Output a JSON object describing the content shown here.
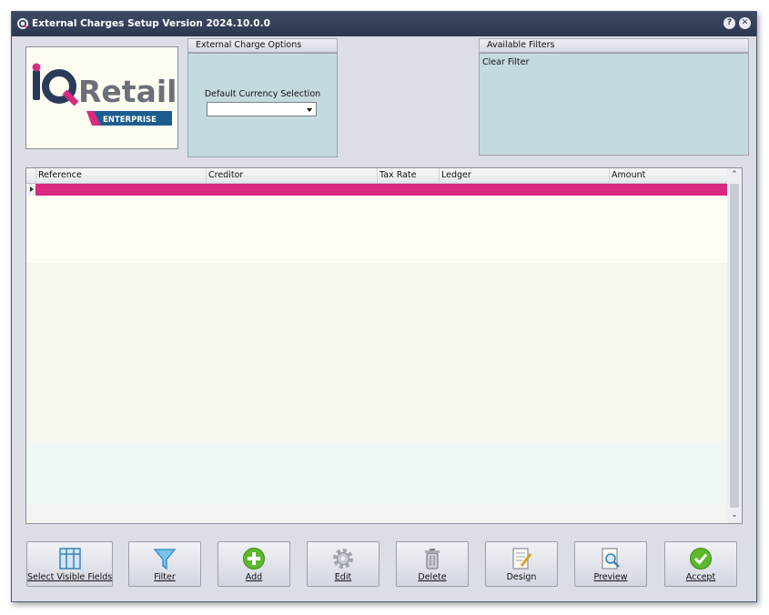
{
  "window": {
    "title": "External Charges Setup Version 2024.10.0.0",
    "help_glyph": "?",
    "close_glyph": "✕"
  },
  "logo": {
    "text_iq": "iQ",
    "text_retail": "Retail",
    "text_badge": "ENTERPRISE"
  },
  "options_group": {
    "header": "External Charge Options",
    "currency_label": "Default Currency Selection",
    "currency_value": ""
  },
  "filters_group": {
    "header": "Available Filters",
    "items": [
      "Clear Filter"
    ]
  },
  "grid": {
    "columns": [
      "Reference",
      "Creditor",
      "Tax Rate",
      "Ledger",
      "Amount"
    ]
  },
  "buttons": [
    {
      "label": "Select Visible Fields",
      "icon": "columns-icon"
    },
    {
      "label": "Filter",
      "icon": "funnel-icon"
    },
    {
      "label": "Add",
      "icon": "plus-circle-icon"
    },
    {
      "label": "Edit",
      "icon": "gear-icon"
    },
    {
      "label": "Delete",
      "icon": "trash-icon"
    },
    {
      "label": "Design",
      "icon": "pencil-document-icon"
    },
    {
      "label": "Preview",
      "icon": "magnifier-document-icon"
    },
    {
      "label": "Accept",
      "icon": "checkmark-icon"
    }
  ],
  "colors": {
    "titlebar": "#2c3850",
    "group_body": "#c5dadd",
    "selected_row": "#d72a80",
    "add_green": "#5cb82c"
  }
}
